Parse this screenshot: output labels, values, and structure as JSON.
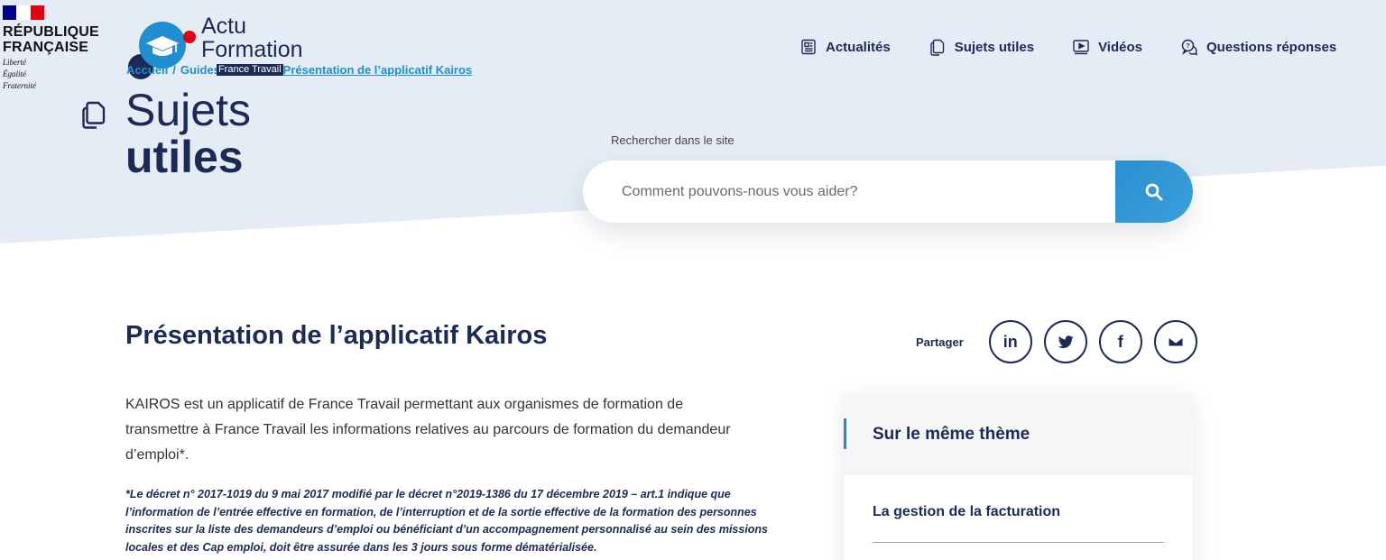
{
  "brand": {
    "rf_name_line1": "RÉPUBLIQUE",
    "rf_name_line2": "FRANÇAISE",
    "rf_motto_1": "Liberté",
    "rf_motto_2": "Égalité",
    "rf_motto_3": "Fraternité",
    "logo_line1": "Actu",
    "logo_line2": "Formation"
  },
  "breadcrumb": {
    "home": "Accueil",
    "separator": "/",
    "guides": "Guides",
    "badge": "France Travail",
    "current": "Présentation de l’applicatif Kairos"
  },
  "nav": {
    "items": [
      {
        "label": "Actualités",
        "icon": "newspaper-icon"
      },
      {
        "label": "Sujets utiles",
        "icon": "documents-icon"
      },
      {
        "label": "Vidéos",
        "icon": "video-icon"
      },
      {
        "label": "Questions réponses",
        "icon": "chat-bubbles-icon"
      }
    ]
  },
  "section": {
    "title_line1": "Sujets",
    "title_line2": "utiles"
  },
  "search": {
    "label": "Rechercher dans le site",
    "placeholder": "Comment pouvons-nous vous aider?"
  },
  "article": {
    "title": "Présentation de l’applicatif Kairos",
    "body": "KAIROS est un applicatif de France Travail permettant aux organismes de formation de transmettre à France Travail les informations relatives au parcours de formation du demandeur d’emploi*.",
    "note": "*Le décret n° 2017-1019 du 9 mai 2017 modifié par le décret n°2019-1386 du 17 décembre 2019 – art.1 indique que l’information de l’entrée effective en formation, de l’interruption et de la sortie effective de la formation des personnes inscrites sur la liste des demandeurs d’emploi ou bénéficiant d’un accompagnement personnalisé au sein des missions locales et des Cap emploi, doit être assurée dans les 3 jours sous forme dématérialisée."
  },
  "share": {
    "label": "Partager",
    "buttons": [
      {
        "name": "linkedin",
        "text": "in"
      },
      {
        "name": "twitter",
        "text": ""
      },
      {
        "name": "facebook",
        "text": "f"
      },
      {
        "name": "email",
        "text": ""
      }
    ]
  },
  "sidebar": {
    "title": "Sur le même thème",
    "items": [
      {
        "label": "La gestion de la facturation"
      }
    ]
  },
  "colors": {
    "navy": "#1b2a56",
    "accent_blue": "#1f8fd0",
    "hero_bg": "#e6ecf5",
    "red": "#e1000f"
  }
}
